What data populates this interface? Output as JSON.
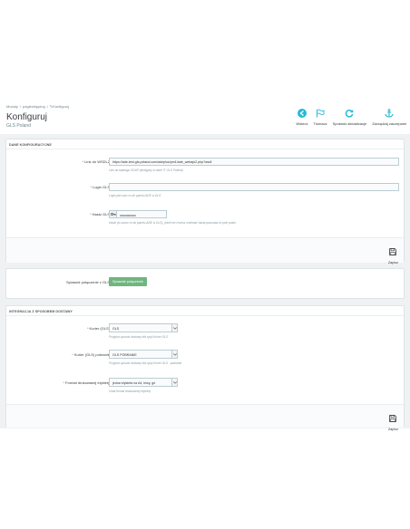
{
  "breadcrumb": {
    "item1": "Moduły",
    "sep": "/",
    "item2": "pdgleshipping",
    "item3": "Konfiguruj"
  },
  "header": {
    "title": "Konfiguruj",
    "subtitle": "GLS Poland"
  },
  "toolbar": {
    "back": "Wstecz",
    "translate": "Tłumacz",
    "check_update": "Sprawdź aktualizacje",
    "hooks": "Zarządzaj zaczepami"
  },
  "config_panel": {
    "heading": "DANE KONFIGURACYJNE",
    "wsdl_label": "Link do WSDL2",
    "wsdl_value": "https://ade-test.gls-poland.com/adeplus/pm1/ade_webapi2.php?wsdl",
    "wsdl_help": "Link do katalogu SOAP (dostępny w dane IT GLS Poland)",
    "login_label": "Login GLS",
    "login_value": "",
    "login_help": "Login jaki sam co do panelu ADE w GLS",
    "pass_label": "Hasło GLS",
    "pass_value": "••••••••••••••••",
    "pass_help": "Hasło (to samo co do panelu ADE w GLS), jeżeli nie chcesz zmieniać hasła pozostaw to pole puste.",
    "save": "Zapisz"
  },
  "test_panel": {
    "label": "Sprawdź połączenie z GLS",
    "button": "Sprawdź połączenie"
  },
  "delivery_panel": {
    "heading": "INTEGRACJA Z SPOSOBEM DOSTAWY",
    "courier_label": "Kurier (GLS)",
    "courier_value": "GLS",
    "courier_help": "Przypisz sposób dostawy dla opcji Kurier GLS",
    "cod_label": "Kurier (GLS) pobranie",
    "cod_value": "GLS POBRANIE",
    "cod_help": "Przypisz sposób dostawy dla opcji Kurier GLS - pobranie",
    "format_label": "Format drukowanej etykiety",
    "format_value": "jedna etykieta na A4, lewy, gó",
    "format_help": "Ustal format drukowanej etykiety",
    "save": "Zapisz"
  },
  "colors": {
    "accent": "#25b9d7",
    "success": "#70b580",
    "required": "#c05c67"
  },
  "icons": {
    "back": "arrow-circle-left-icon",
    "translate": "flag-icon",
    "check_update": "refresh-icon",
    "hooks": "anchor-icon",
    "save": "floppy-disk-icon",
    "password": "key-icon",
    "select": "chevron-down-icon"
  }
}
